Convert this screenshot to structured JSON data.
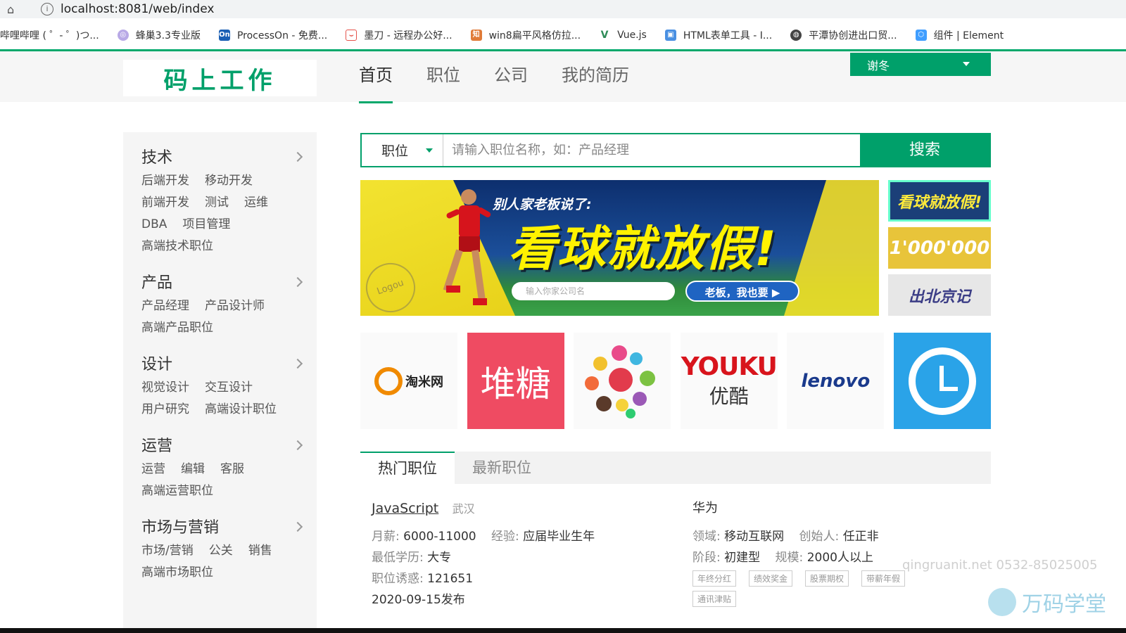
{
  "browser": {
    "url": "localhost:8081/web/index",
    "bookmarks": [
      {
        "label": "哔哩哔哩 ( ゜- ゜)つ...",
        "icon": "bilibili-icon",
        "color": "#ffffff"
      },
      {
        "label": "蜂巢3.3专业版",
        "icon": "hive-icon",
        "color": "#b8a9e6"
      },
      {
        "label": "ProcessOn - 免费...",
        "icon": "processon-icon",
        "color": "#1a5fb4"
      },
      {
        "label": "墨刀 - 远程办公好...",
        "icon": "modao-icon",
        "color": "#e5534b"
      },
      {
        "label": "win8扁平风格仿拉...",
        "icon": "zhihu-icon",
        "color": "#e07b39"
      },
      {
        "label": "Vue.js",
        "icon": "vue-icon",
        "color": "#2e8b57"
      },
      {
        "label": "HTML表单工具 - I...",
        "icon": "form-icon",
        "color": "#4a90e2"
      },
      {
        "label": "平潭协创进出口贸...",
        "icon": "globe-icon",
        "color": "#444444"
      },
      {
        "label": "组件 | Element",
        "icon": "element-icon",
        "color": "#409eff"
      }
    ]
  },
  "header": {
    "logo": "码上工作",
    "nav": [
      "首页",
      "职位",
      "公司",
      "我的简历"
    ],
    "user": "谢冬"
  },
  "sidebar": {
    "categories": [
      {
        "title": "技术",
        "rows": [
          [
            "后端开发",
            "移动开发"
          ],
          [
            "前端开发",
            "测试",
            "运维"
          ],
          [
            "DBA",
            "项目管理"
          ],
          [
            "高端技术职位"
          ]
        ]
      },
      {
        "title": "产品",
        "rows": [
          [
            "产品经理",
            "产品设计师"
          ],
          [
            "高端产品职位"
          ]
        ]
      },
      {
        "title": "设计",
        "rows": [
          [
            "视觉设计",
            "交互设计"
          ],
          [
            "用户研究",
            "高端设计职位"
          ]
        ]
      },
      {
        "title": "运营",
        "rows": [
          [
            "运营",
            "编辑",
            "客服"
          ],
          [
            "高端运营职位"
          ]
        ]
      },
      {
        "title": "市场与营销",
        "rows": [
          [
            "市场/营销",
            "公关",
            "销售"
          ],
          [
            "高端市场职位"
          ]
        ]
      }
    ]
  },
  "search": {
    "type": "职位",
    "placeholder": "请输入职位名称，如：产品经理",
    "button": "搜索"
  },
  "banner": {
    "headline_small": "别人家老板说了:",
    "headline_big": "看球就放假!",
    "input_placeholder": "输入你家公司名",
    "cta": "老板，我也要",
    "stamp": "Logou"
  },
  "thumbs": [
    "看球就放假!",
    "1'000'000",
    "出北京记"
  ],
  "logos": {
    "taomi": "淘米网",
    "duitang": "堆糖",
    "youku_en": "YOUKU",
    "youku_cn": "优酷",
    "lenovo": "lenovo"
  },
  "tabs": [
    "热门职位",
    "最新职位"
  ],
  "job": {
    "title": "JavaScript",
    "city": "武汉",
    "salary_label": "月薪:",
    "salary": "6000-11000",
    "exp_label": "经验:",
    "exp": "应届毕业生年",
    "edu_label": "最低学历:",
    "edu": "大专",
    "lure_label": "职位诱惑:",
    "lure": "121651",
    "date": "2020-09-15发布",
    "company": "华为",
    "field_label": "领域:",
    "field": "移动互联网",
    "founder_label": "创始人:",
    "founder": "任正非",
    "stage_label": "阶段:",
    "stage": "初建型",
    "scale_label": "规模:",
    "scale": "2000人以上",
    "tags": [
      "年终分红",
      "绩效奖金",
      "股票期权",
      "带薪年假",
      "通讯津贴"
    ]
  },
  "watermark": {
    "text": "qingruanit.net 0532-85025005",
    "brand": "万码学堂"
  }
}
